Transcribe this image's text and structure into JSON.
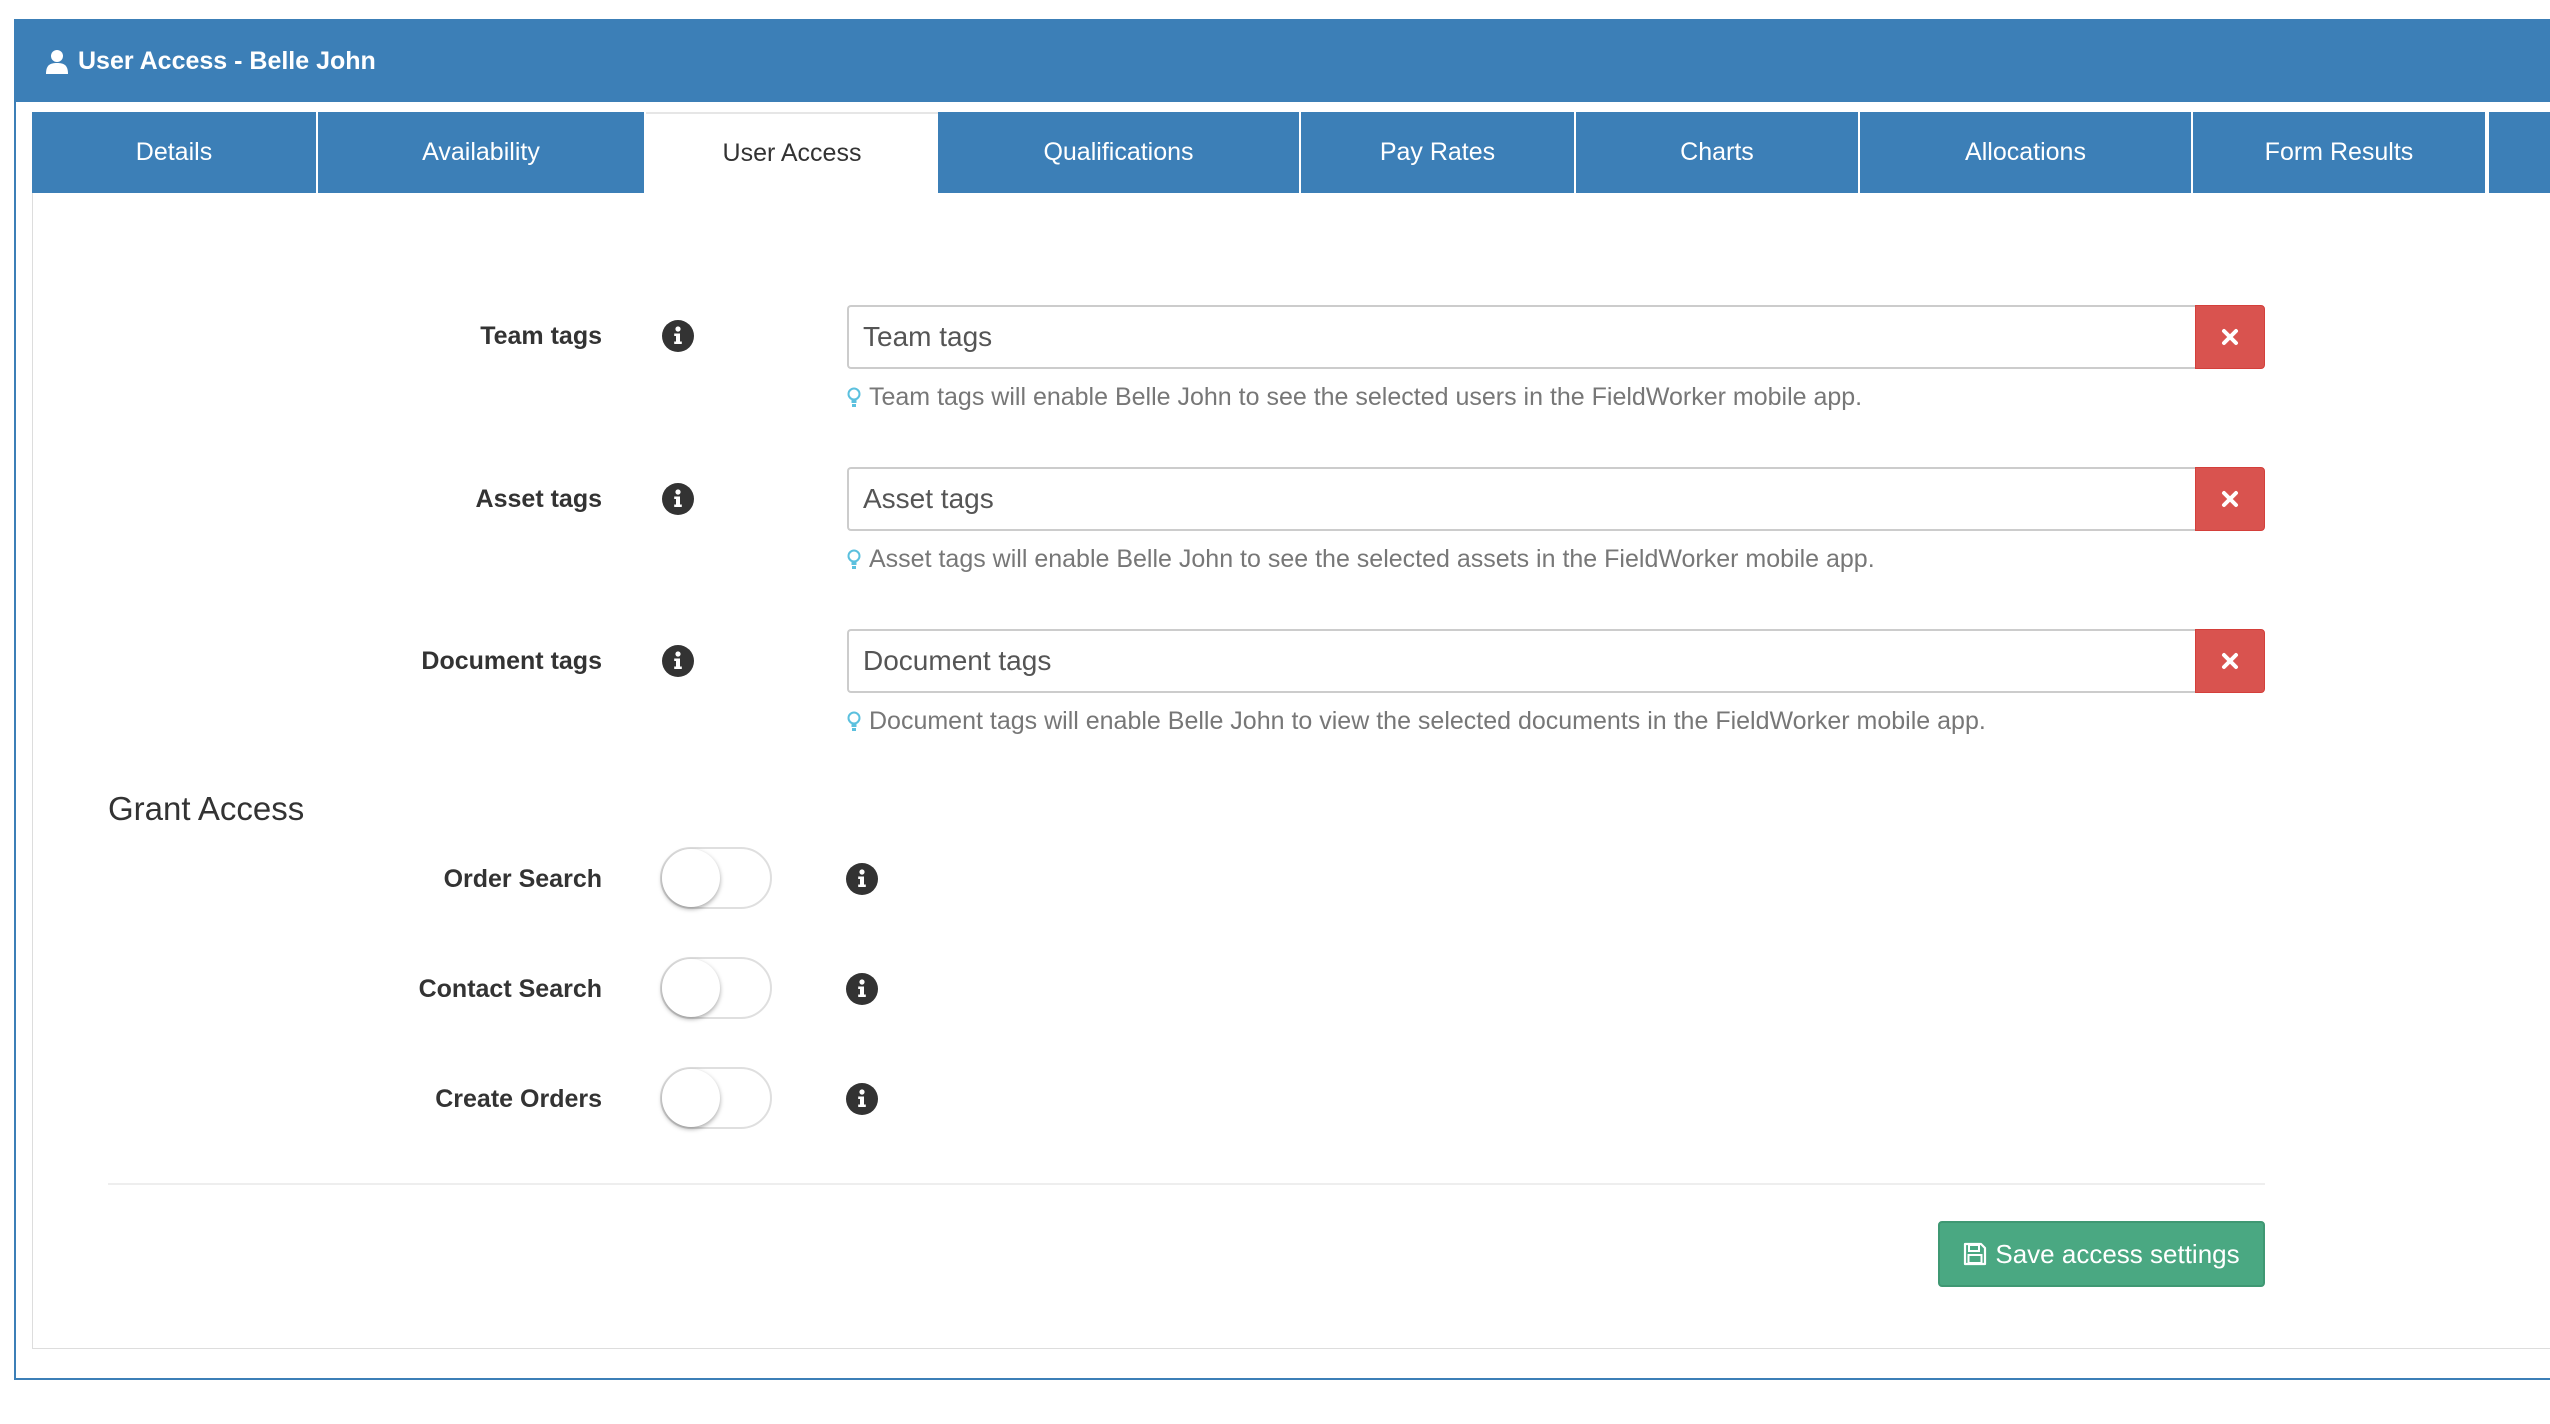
{
  "header": {
    "title": "User Access - Belle John",
    "icon": "user-icon"
  },
  "tabs": [
    {
      "label": "Details",
      "active": false
    },
    {
      "label": "Availability",
      "active": false
    },
    {
      "label": "User Access",
      "active": true
    },
    {
      "label": "Qualifications",
      "active": false
    },
    {
      "label": "Pay Rates",
      "active": false
    },
    {
      "label": "Charts",
      "active": false
    },
    {
      "label": "Allocations",
      "active": false
    },
    {
      "label": "Form Results",
      "active": false
    }
  ],
  "tag_fields": {
    "team": {
      "label": "Team tags",
      "placeholder": "Team tags",
      "help": "Team tags will enable Belle John to see the selected users in the FieldWorker mobile app."
    },
    "asset": {
      "label": "Asset tags",
      "placeholder": "Asset tags",
      "help": "Asset tags will enable Belle John to see the selected assets in the FieldWorker mobile app."
    },
    "document": {
      "label": "Document tags",
      "placeholder": "Document tags",
      "help": "Document tags will enable Belle John to view the selected documents in the FieldWorker mobile app."
    }
  },
  "grant_access": {
    "title": "Grant Access",
    "order_search": {
      "label": "Order Search",
      "enabled": false
    },
    "contact_search": {
      "label": "Contact Search",
      "enabled": false
    },
    "create_orders": {
      "label": "Create Orders",
      "enabled": false
    }
  },
  "save_button": {
    "label": "Save access settings",
    "icon": "floppy-disk-icon"
  },
  "colors": {
    "primary": "#3c7fb7",
    "danger": "#d9534f",
    "success": "#4aa882",
    "help_icon": "#5bc0de"
  }
}
